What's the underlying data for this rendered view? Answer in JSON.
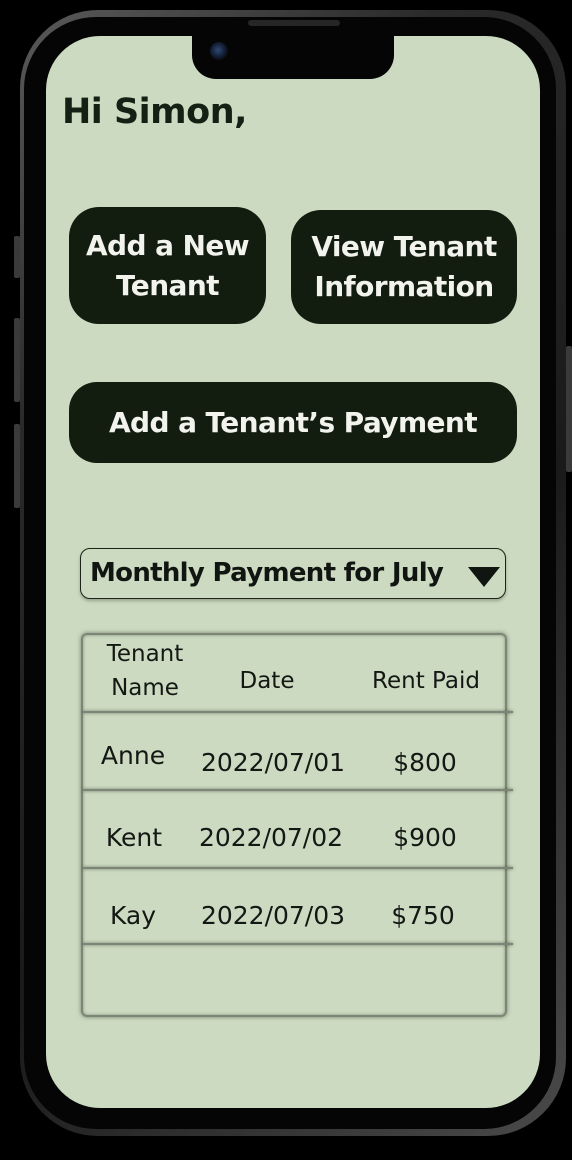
{
  "greeting": "Hi Simon,",
  "actions": {
    "add_new_tenant": "Add a New Tenant",
    "view_tenant_information": "View Tenant Information",
    "add_tenant_payment": "Add a Tenant’s Payment"
  },
  "month_selector": {
    "selected": "Monthly Payment for July",
    "icon": "caret-down-icon"
  },
  "payments_table": {
    "headers": [
      "Tenant Name",
      "Date",
      "Rent Paid"
    ],
    "rows": [
      {
        "name": "Anne",
        "date": "2022/07/01",
        "rent": "$800"
      },
      {
        "name": "Kent",
        "date": "2022/07/02",
        "rent": "$900"
      },
      {
        "name": "Kay",
        "date": "2022/07/03",
        "rent": "$750"
      }
    ]
  },
  "colors": {
    "screen_background": "#cbdac0",
    "button_background": "#131d0f",
    "button_text": "#f1f3ec",
    "text_dark": "#152014"
  }
}
